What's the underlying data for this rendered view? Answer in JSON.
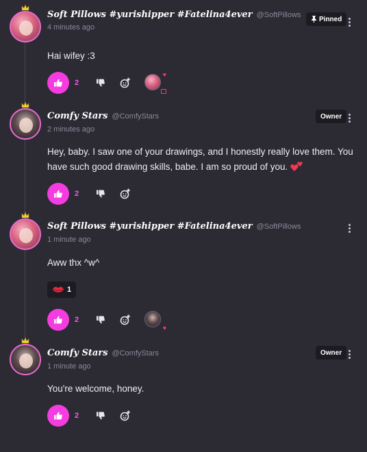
{
  "colors": {
    "background": "#2c2a33",
    "accent": "#f43ce0",
    "like_count": "#f45ee6",
    "badge_bg": "#1d1b22",
    "muted": "#8d899a",
    "heart": "#ff3b6a"
  },
  "comments": [
    {
      "display_name": "Soft Pillows #yurishipper #Fatelina4ever",
      "handle": "@SoftPillows",
      "timestamp": "4 minutes ago",
      "badge": "Pinned",
      "badge_icon": "pin-icon",
      "body": "Hai wifey :3",
      "likes": "2",
      "avatar_icon": "user-avatar-pink-hair"
    },
    {
      "display_name": "Comfy Stars",
      "handle": "@ComfyStars",
      "timestamp": "2 minutes ago",
      "badge": "Owner",
      "body": "Hey, baby. I saw one of your drawings, and I honestly really love them. You have such good drawing skills, babe. I am so proud of you.",
      "body_emoji": "two-hearts-emoji",
      "likes": "2",
      "avatar_icon": "user-avatar-dark-hair"
    },
    {
      "display_name": "Soft Pillows #yurishipper #Fatelina4ever",
      "handle": "@SoftPillows",
      "timestamp": "1 minute ago",
      "body": "Aww thx ^w^",
      "reaction": {
        "emoji": "kiss-lips-emoji",
        "count": "1"
      },
      "likes": "2",
      "avatar_icon": "user-avatar-pink-hair"
    },
    {
      "display_name": "Comfy Stars",
      "handle": "@ComfyStars",
      "timestamp": "1 minute ago",
      "badge": "Owner",
      "body": "You're welcome, honey.",
      "likes": "2",
      "avatar_icon": "user-avatar-dark-hair"
    }
  ]
}
